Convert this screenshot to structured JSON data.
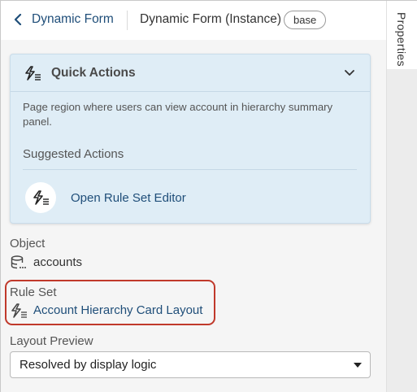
{
  "header": {
    "back_link": "Dynamic Form",
    "title": "Dynamic Form (Instance)",
    "badge": "base"
  },
  "side_panel": {
    "tab_label": "Properties"
  },
  "quick_actions": {
    "title": "Quick Actions",
    "description": "Page region where users can view account in hierarchy summary panel.",
    "suggested_heading": "Suggested Actions",
    "actions": [
      {
        "label": "Open Rule Set Editor",
        "icon": "rule-set-icon"
      }
    ]
  },
  "object": {
    "label": "Object",
    "value": "accounts",
    "icon": "database-icon"
  },
  "rule_set": {
    "label": "Rule Set",
    "value": "Account Hierarchy Card Layout",
    "icon": "rule-set-icon",
    "highlight_color": "#c0392b"
  },
  "layout_preview": {
    "label": "Layout Preview",
    "selected": "Resolved by display logic"
  },
  "colors": {
    "link": "#1f4e79",
    "card_bg": "#dfedf6"
  }
}
